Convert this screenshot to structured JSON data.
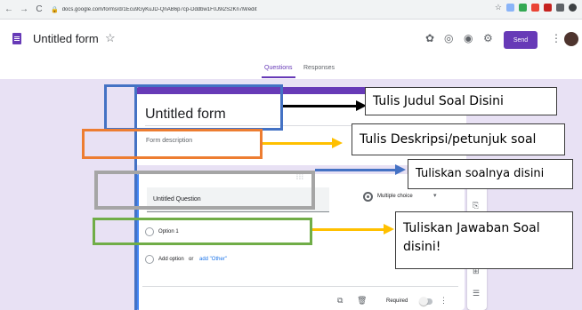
{
  "browser": {
    "back_icon": "back-arrow",
    "forward_icon": "forward-arrow",
    "reload_icon": "reload",
    "url": "docs.google.com/forms/d/1Ecu9GyKuJD-QnAB6p7cp-Dddbw1F0J9i2S2Kn7M/edit"
  },
  "header": {
    "title": "Untitled form",
    "send_label": "Send",
    "brand_color": "#673ab7"
  },
  "tabs": [
    {
      "label": "Questions",
      "active": true
    },
    {
      "label": "Responses",
      "active": false
    }
  ],
  "form": {
    "title": "Untitled form",
    "description_placeholder": "Form description",
    "accent_color": "#673ab7",
    "background_color": "#e8e1f4"
  },
  "question": {
    "text": "Untitled Question",
    "type": "Multiple choice",
    "options": [
      "Option 1"
    ],
    "add_option_label": "Add option",
    "or_label": "or",
    "add_other_label": "add \"Other\"",
    "required_label": "Required",
    "required": false
  },
  "annotations": [
    {
      "text": "Tulis Judul Soal Disini",
      "arrow_color": "#000000"
    },
    {
      "text": "Tulis Deskripsi/petunjuk soal",
      "arrow_color": "#ffc000"
    },
    {
      "text": "Tuliskan soalnya disini",
      "arrow_color": "#4472c4"
    },
    {
      "text_lines": [
        "Tuliskan Jawaban Soal",
        "disini!"
      ],
      "arrow_color": "#ffc000"
    }
  ],
  "box_colors": {
    "title": "#4472c4",
    "description": "#ed7d31",
    "question": "#a5a5a5",
    "answer": "#70ad47"
  }
}
